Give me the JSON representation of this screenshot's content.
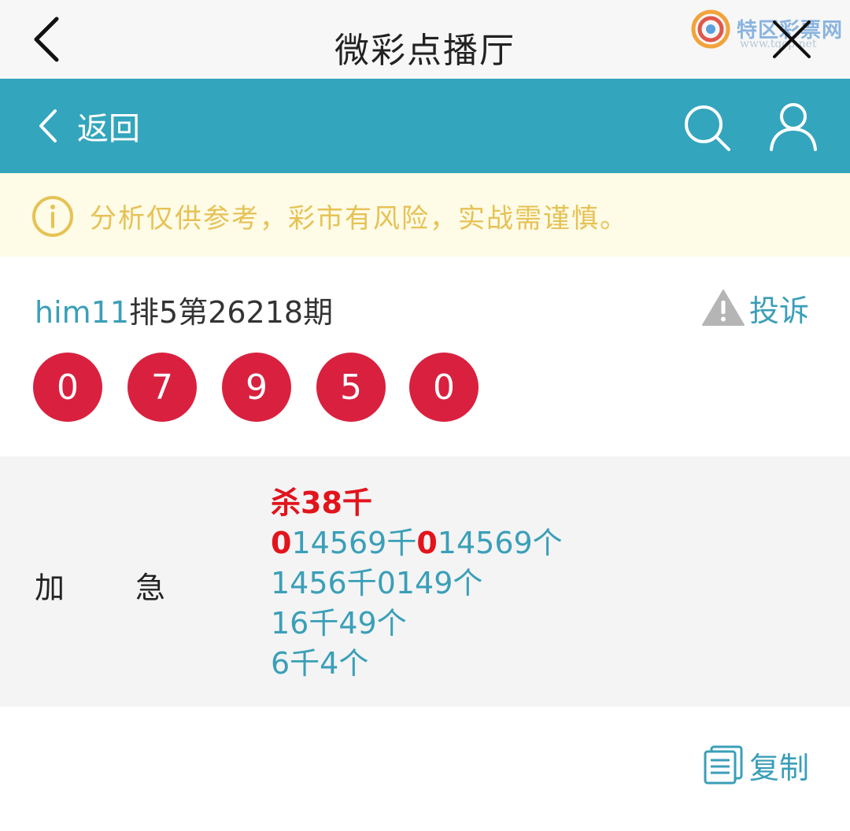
{
  "titlebar": {
    "title": "微彩点播厅"
  },
  "watermark": {
    "brand": "特区彩票网",
    "url": "www.tqcp.net"
  },
  "nav": {
    "back_label": "返回"
  },
  "notice": {
    "text": "分析仅供参考，彩市有风险，实战需谨慎。"
  },
  "post": {
    "author": "him11",
    "issue": "排5第26218期",
    "complain_label": "投诉",
    "balls": [
      "0",
      "7",
      "9",
      "5",
      "0"
    ]
  },
  "analysis": {
    "label_left": "加",
    "label_right": "急",
    "kill_line": "杀38千",
    "line1": {
      "a_red": "0",
      "a_rest": "14569千",
      "b_red": "0",
      "b_rest": "14569个"
    },
    "line2": "1456千0149个",
    "line3": "16千49个",
    "line4": "6千4个"
  },
  "copy": {
    "label": "复制"
  },
  "colors": {
    "teal": "#33a5bd",
    "ball_red": "#d9213f",
    "text_teal": "#3a9fb8",
    "warn_yellow": "#e6c255",
    "kill_red": "#e2141c"
  }
}
